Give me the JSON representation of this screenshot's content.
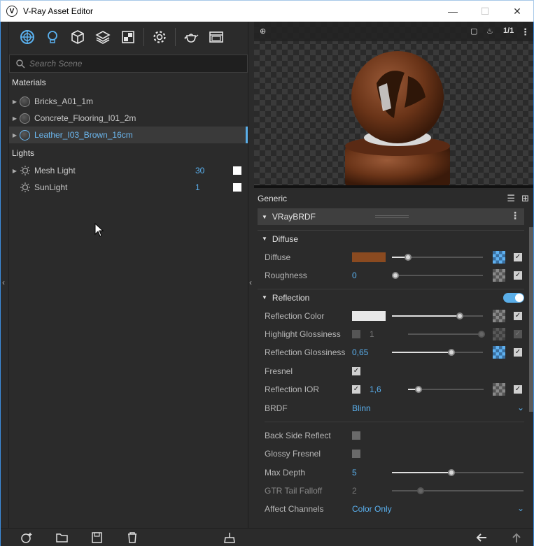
{
  "window": {
    "title": "V-Ray Asset Editor",
    "minimize": "—",
    "maximize": "☐",
    "close": "✕"
  },
  "search": {
    "placeholder": "Search Scene"
  },
  "materials": {
    "header": "Materials",
    "items": [
      {
        "name": "Bricks_A01_1m"
      },
      {
        "name": "Concrete_Flooring_I01_2m"
      },
      {
        "name": "Leather_I03_Brown_16cm"
      }
    ]
  },
  "lights": {
    "header": "Lights",
    "items": [
      {
        "name": "Mesh Light",
        "value": "30"
      },
      {
        "name": "SunLight",
        "value": "1"
      }
    ]
  },
  "preview": {
    "ratio": "1/1"
  },
  "generic": {
    "header": "Generic"
  },
  "brdf_panel": {
    "title": "VRayBRDF"
  },
  "diffuse": {
    "header": "Diffuse",
    "diffuse_label": "Diffuse",
    "diffuse_color": "#8a4a20",
    "roughness_label": "Roughness",
    "roughness_value": "0"
  },
  "reflection": {
    "header": "Reflection",
    "color_label": "Reflection Color",
    "color": "#e8e8e8",
    "highlight_label": "Highlight Glossiness",
    "highlight_value": "1",
    "gloss_label": "Reflection Glossiness",
    "gloss_value": "0,65",
    "fresnel_label": "Fresnel",
    "ior_label": "Reflection IOR",
    "ior_value": "1,6",
    "brdf_label": "BRDF",
    "brdf_value": "Blinn",
    "backside_label": "Back Side Reflect",
    "glossy_fresnel_label": "Glossy Fresnel",
    "max_depth_label": "Max Depth",
    "max_depth_value": "5",
    "gtr_label": "GTR Tail Falloff",
    "gtr_value": "2",
    "affect_label": "Affect Channels",
    "affect_value": "Color Only"
  },
  "colors": {
    "accent": "#5ab0ee",
    "panel": "#2b2b2b",
    "frame": "#3d8ee0"
  }
}
